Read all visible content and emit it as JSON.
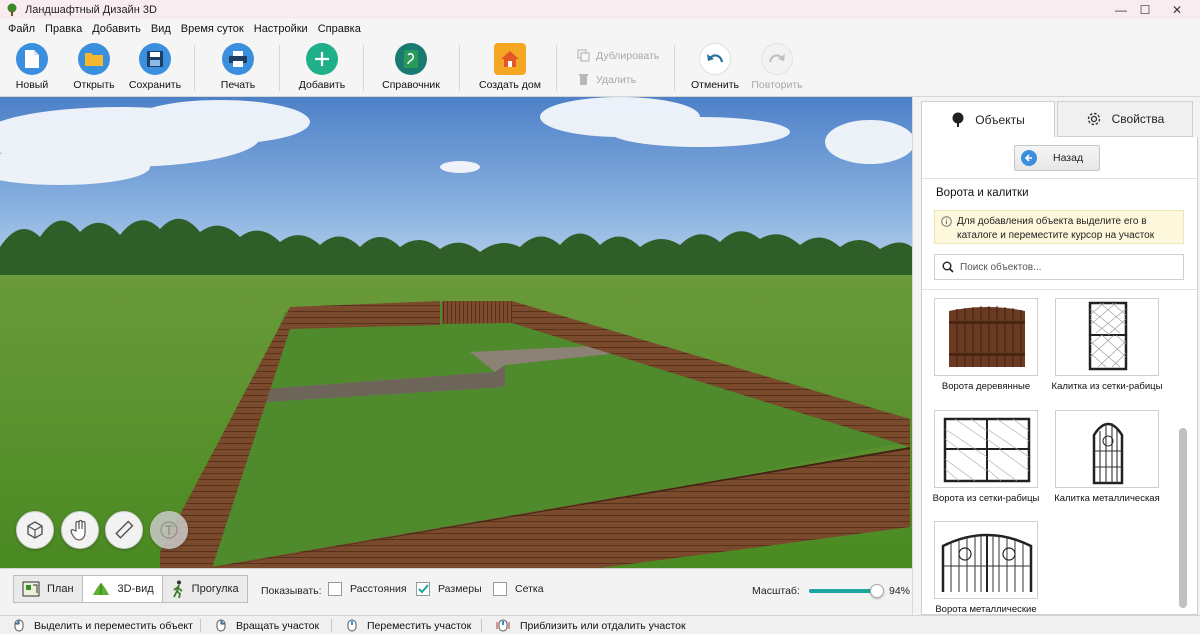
{
  "window": {
    "title": "Ландшафтный Дизайн 3D",
    "minimize": "—",
    "maximize": "☐",
    "close": "✕"
  },
  "menu": [
    "Файл",
    "Правка",
    "Добавить",
    "Вид",
    "Время суток",
    "Настройки",
    "Справка"
  ],
  "toolbar": {
    "new": "Новый",
    "open": "Открыть",
    "save": "Сохранить",
    "print": "Печать",
    "add": "Добавить",
    "reference": "Справочник",
    "create_house": "Создать дом",
    "duplicate": "Дублировать",
    "delete": "Удалить",
    "undo": "Отменить",
    "redo": "Повторить"
  },
  "panel": {
    "tab_objects": "Объекты",
    "tab_properties": "Свойства",
    "back": "Назад",
    "section_title": "Ворота и калитки",
    "info": "Для добавления объекта выделите его в каталоге и переместите курсор на участок",
    "search_placeholder": "Поиск объектов...",
    "items": [
      {
        "label": "Ворота деревянные",
        "icon": "wooden-gate-icon"
      },
      {
        "label": "Калитка из сетки-рабицы",
        "icon": "mesh-wicket-icon"
      },
      {
        "label": "Ворота из сетки-рабицы",
        "icon": "mesh-gate-icon"
      },
      {
        "label": "Калитка металлическая",
        "icon": "metal-wicket-icon"
      },
      {
        "label": "Ворота металлические",
        "icon": "metal-gate-icon"
      }
    ]
  },
  "viewbar": {
    "modes": [
      "План",
      "3D-вид",
      "Прогулка"
    ],
    "active_mode": "3D-вид",
    "show_label": "Показывать:",
    "checkboxes": [
      {
        "label": "Расстояния",
        "checked": false
      },
      {
        "label": "Размеры",
        "checked": true
      },
      {
        "label": "Сетка",
        "checked": false
      }
    ],
    "scale_label": "Масштаб:",
    "scale_value": "94%",
    "scale_fraction": 0.94
  },
  "status": [
    "Выделить и переместить объект",
    "Вращать участок",
    "Переместить участок",
    "Приблизить или отдалить участок"
  ],
  "colors": {
    "accent_teal": "#1fa5a0",
    "accent_blue": "#3a8fde",
    "grass": "#4f8a2c",
    "fence_wood": "#7a4a2c"
  }
}
